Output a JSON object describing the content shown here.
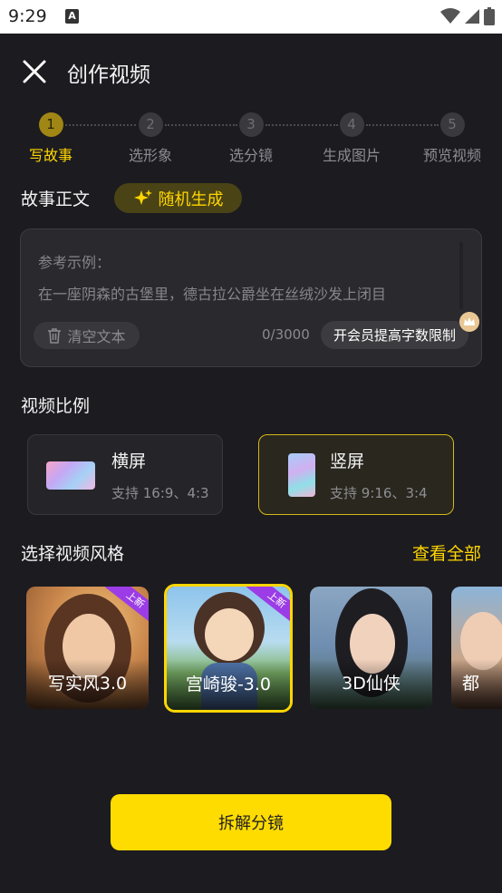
{
  "status_bar": {
    "time": "9:29",
    "a_icon": "A"
  },
  "header": {
    "title": "创作视频"
  },
  "steps": [
    {
      "number": "1",
      "label": "写故事",
      "active": true
    },
    {
      "number": "2",
      "label": "选形象",
      "active": false
    },
    {
      "number": "3",
      "label": "选分镜",
      "active": false
    },
    {
      "number": "4",
      "label": "生成图片",
      "active": false
    },
    {
      "number": "5",
      "label": "预览视频",
      "active": false
    }
  ],
  "story": {
    "section_title": "故事正文",
    "random_label": "随机生成",
    "placeholder_line1": "参考示例：",
    "placeholder_line2": "在一座阴森的古堡里，德古拉公爵坐在丝绒沙发上闭目",
    "clear_label": "清空文本",
    "char_count": "0/3000",
    "vip_label": "开会员提高字数限制"
  },
  "ratio": {
    "section_title": "视频比例",
    "options": [
      {
        "name": "横屏",
        "sub": "支持 16:9、4:3",
        "selected": false
      },
      {
        "name": "竖屏",
        "sub": "支持 9:16、3:4",
        "selected": true
      }
    ]
  },
  "style": {
    "section_title": "选择视频风格",
    "see_all": "查看全部",
    "cards": [
      {
        "name": "写实风3.0",
        "badge": "上新",
        "selected": false
      },
      {
        "name": "宫崎骏-3.0",
        "badge": "上新",
        "selected": true
      },
      {
        "name": "3D仙侠",
        "badge": "",
        "selected": false
      },
      {
        "name": "都",
        "badge": "",
        "selected": false
      }
    ]
  },
  "action": {
    "primary_label": "拆解分镜"
  },
  "colors": {
    "accent": "#ffd600",
    "background": "#1c1b20",
    "badge": "#9b3ce6"
  }
}
